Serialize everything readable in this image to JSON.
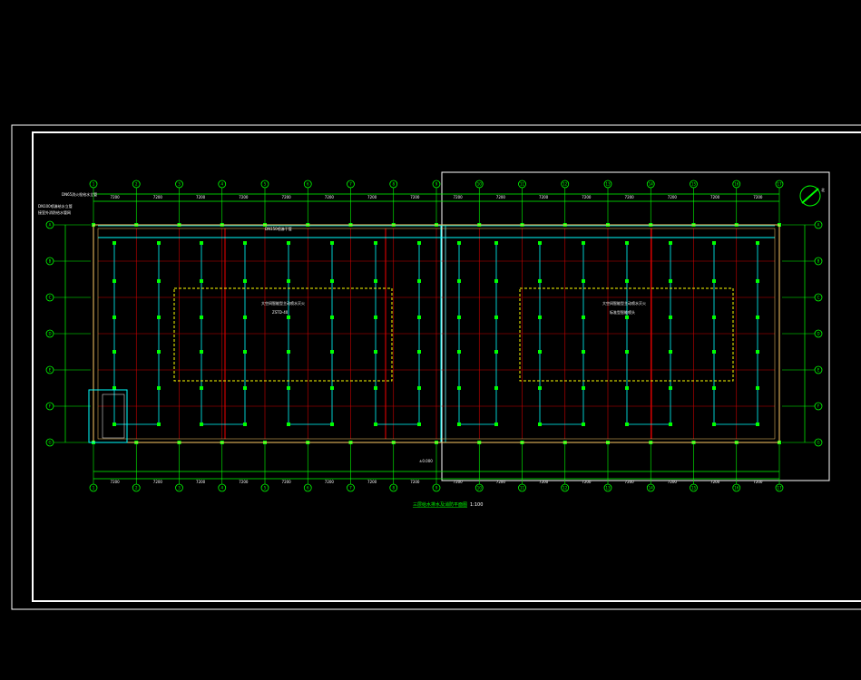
{
  "drawing": {
    "title": "三层给水排水及消防平面图",
    "scale": "1:100",
    "colors": {
      "background": "#000000",
      "frame": "#ffffff",
      "axis": "#00ff00",
      "grid": "#cc0000",
      "pipe": "#00ffff",
      "dash": "#ffff00",
      "wall": "#ffcc66"
    },
    "axis_labels_top": [
      "1",
      "2",
      "3",
      "4",
      "5",
      "6",
      "7",
      "8",
      "9",
      "10",
      "11",
      "12",
      "13",
      "14",
      "15",
      "16",
      "17"
    ],
    "axis_labels_side": [
      "A",
      "B",
      "C",
      "D",
      "E",
      "F",
      "G"
    ],
    "dimension_value": "7200",
    "left_notes": [
      "DN65消火栓给水立管",
      "DN100喷淋给水立管",
      "接室外消防给水管网"
    ],
    "room_labels": [
      "大空间智能型主动喷水灭火",
      "大空间智能型主动喷水灭火"
    ],
    "sub_notes": [
      "ZSTD-40",
      "标准型智能喷头"
    ],
    "pipe_note": "DN150喷淋干管",
    "elevation_mark": "±0.000",
    "north_icon": "north-arrow-icon"
  }
}
